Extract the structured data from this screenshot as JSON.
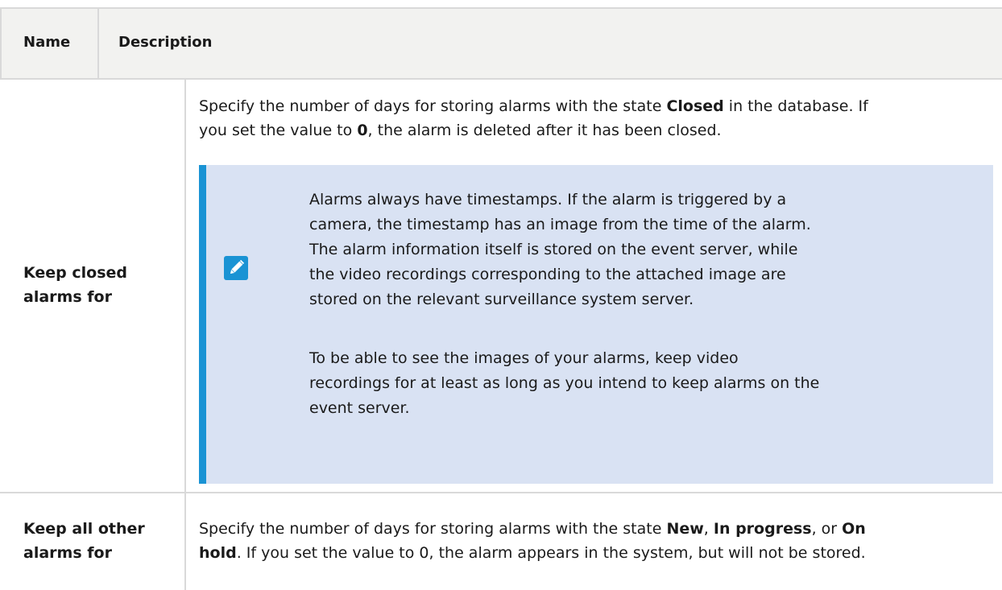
{
  "table": {
    "header": {
      "name": "Name",
      "description": "Description"
    },
    "rows": [
      {
        "name_line1": "Keep closed",
        "name_line2": "alarms for",
        "desc_line1": {
          "a": "Specify the number of days for storing alarms with the state ",
          "b": "Closed",
          "c": " in the database. If"
        },
        "desc_line2": {
          "a": "you set the value to ",
          "b": "0",
          "c": ", the alarm is deleted after it has been closed."
        },
        "note": {
          "icon": "pencil-icon",
          "p1": [
            "Alarms always have timestamps. If the alarm is triggered by a",
            "camera, the timestamp has an image from the time of the alarm.",
            "The alarm information itself is stored on the event server, while",
            "the video recordings corresponding to the attached image are",
            "stored on the relevant surveillance system server."
          ],
          "p2": [
            "To be able to see the images of your alarms, keep video",
            "recordings for at least as long as you intend to keep alarms on the",
            "event server."
          ]
        }
      },
      {
        "name_line1": "Keep all other",
        "name_line2": "alarms for",
        "desc_line1": {
          "a": "Specify the number of days for storing alarms with the state ",
          "b": "New",
          "c": ", ",
          "d": "In progress",
          "e": ", or ",
          "f": "On"
        },
        "desc_line2": {
          "a": "hold",
          "b": ". If you set the value to 0, the alarm appears in the system, but will not be stored."
        }
      }
    ]
  },
  "colors": {
    "header_bg": "#f2f2f0",
    "grid": "#d9d9d9",
    "note_bg": "#d9e2f3",
    "accent": "#1a93d4"
  }
}
